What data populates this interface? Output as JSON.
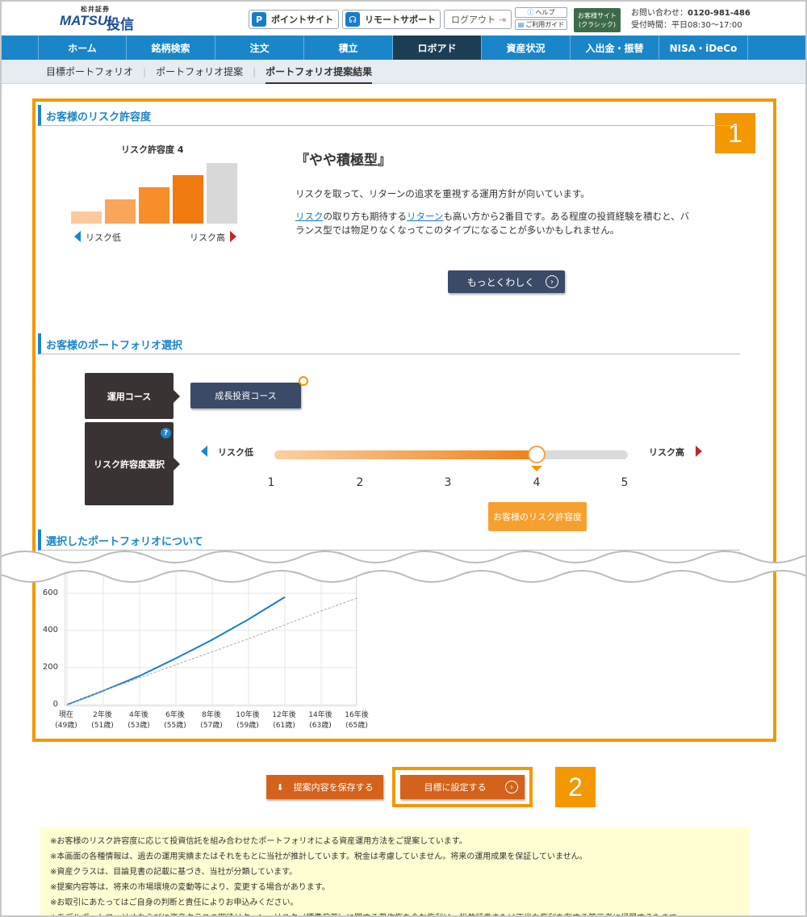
{
  "header": {
    "logo_sub": "松井証券",
    "logo_main": "MATSUI",
    "logo_kanji": "投信",
    "point_site": "ポイントサイト",
    "point_icon": "P",
    "remote_support": "リモートサポート",
    "logout": "ログアウト",
    "help": "ヘルプ",
    "guide": "ご利用ガイド",
    "classic_line1": "お客様サイト",
    "classic_line2": "(クラシック)",
    "contact_label": "お問い合わせ：",
    "contact_phone": "0120-981-486",
    "hours": "受付時間：平日08:30〜17:00"
  },
  "nav": {
    "items": [
      {
        "label": "ホーム"
      },
      {
        "label": "銘柄検索"
      },
      {
        "label": "注文"
      },
      {
        "label": "積立"
      },
      {
        "label": "ロボアド"
      },
      {
        "label": "資産状況"
      },
      {
        "label": "入出金・振替"
      },
      {
        "label": "NISA・iDeCo"
      }
    ],
    "active_index": 4
  },
  "subnav": {
    "items": [
      "目標ポートフォリオ",
      "ポートフォリオ提案",
      "ポートフォリオ提案結果"
    ],
    "separator": "|"
  },
  "risk": {
    "section_title": "お客様のリスク許容度",
    "chart_title": "リスク許容度 4",
    "low_label": "リスク低",
    "high_label": "リスク高",
    "type_title": "『やや積極型』",
    "desc1": "リスクを取って、リターンの追求を重視する運用方針が向いています。",
    "desc2_link1": "リスク",
    "desc2_a": "の取り方も期待する",
    "desc2_link2": "リターン",
    "desc2_b": "も高い方から2番目です。ある程度の投資経験を積むと、バ",
    "desc2_line2": "ランス型では物足りなくなってこのタイプになることが多いかもしれません。",
    "more_button": "もっとくわしく",
    "bars": [
      {
        "level": 1,
        "color": "#fcc99a"
      },
      {
        "level": 2,
        "color": "#f9a55a"
      },
      {
        "level": 3,
        "color": "#f68e2a"
      },
      {
        "level": 4,
        "color": "#f07a10"
      },
      {
        "level": 5,
        "color": "#d8d8d8"
      }
    ],
    "selected_level": 4
  },
  "portfolio": {
    "section_title": "お客様のポートフォリオ選択",
    "course_label": "運用コース",
    "course_value": "成長投資コース",
    "risk_select_label": "リスク許容度選択",
    "help_icon": "?",
    "low_label": "リスク低",
    "high_label": "リスク高",
    "ticks": [
      "1",
      "2",
      "3",
      "4",
      "5"
    ],
    "slider_value": 4,
    "your_tolerance": "お客様のリスク許容度"
  },
  "selected": {
    "section_title": "選択したポートフォリオについて"
  },
  "chart_data": {
    "type": "line",
    "x": [
      "現在",
      "2年後",
      "4年後",
      "6年後",
      "8年後",
      "10年後",
      "12年後",
      "14年後",
      "16年後"
    ],
    "x_sub": [
      "(49歳)",
      "(51歳)",
      "(53歳)",
      "(55歳)",
      "(57歳)",
      "(59歳)",
      "(61歳)",
      "(63歳)",
      "(65歳)"
    ],
    "yticks": [
      "0",
      "200",
      "400",
      "600"
    ],
    "ylim": [
      0,
      600
    ],
    "series": [
      {
        "color": "#1a7bc8",
        "style": "solid",
        "values": [
          0,
          75,
          155,
          250,
          350,
          460,
          580,
          null,
          null
        ]
      },
      {
        "color": "#aaaaaa",
        "style": "dashed",
        "values": [
          0,
          75,
          145,
          215,
          285,
          355,
          430,
          505,
          575
        ]
      }
    ]
  },
  "actions": {
    "save_button": "提案内容を保存する",
    "set_goal_button": "目標に設定する",
    "badge1": "1",
    "badge2": "2"
  },
  "notes": [
    "※お客様のリスク許容度に応じて投資信託を組み合わせたポートフォリオによる資産運用方法をご提案しています。",
    "※本画面の各種情報は、過去の運用実績またはそれをもとに当社が推計しています。税金は考慮していません。将来の運用成果を保証していません。",
    "※資産クラスは、目論見書の記載に基づき、当社が分類しています。",
    "※提案内容等は、将来の市場環境の変動等により、変更する場合があります。",
    "※お取引にあたってはご自身の判断と責任によりお申込みください。",
    "※モデルポートフォリオならびに資産クラスの期待リターン、リスク（標準偏差）に関する著作権を含む権利は、松井証券または正当な権利を有する第三者に帰属するもので"
  ]
}
